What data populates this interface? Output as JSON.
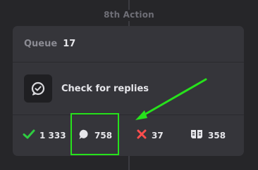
{
  "step": {
    "title": "8th Action"
  },
  "card": {
    "queue_label": "Queue",
    "queue_count": "17",
    "action_label": "Check for replies",
    "action_icon": "chat-check-icon"
  },
  "stats": {
    "completed": {
      "value": "1 333",
      "icon": "checkmark-icon",
      "color": "#2ecc40"
    },
    "replied": {
      "value": "758",
      "icon": "reply-bubble-icon",
      "color": "#e6e6ea"
    },
    "failed": {
      "value": "37",
      "icon": "cross-icon",
      "color": "#ff4d4d"
    },
    "skipped": {
      "value": "358",
      "icon": "skip-icon",
      "color": "#e6e6ea"
    }
  },
  "annotation": {
    "highlight_color": "#27e21c"
  }
}
